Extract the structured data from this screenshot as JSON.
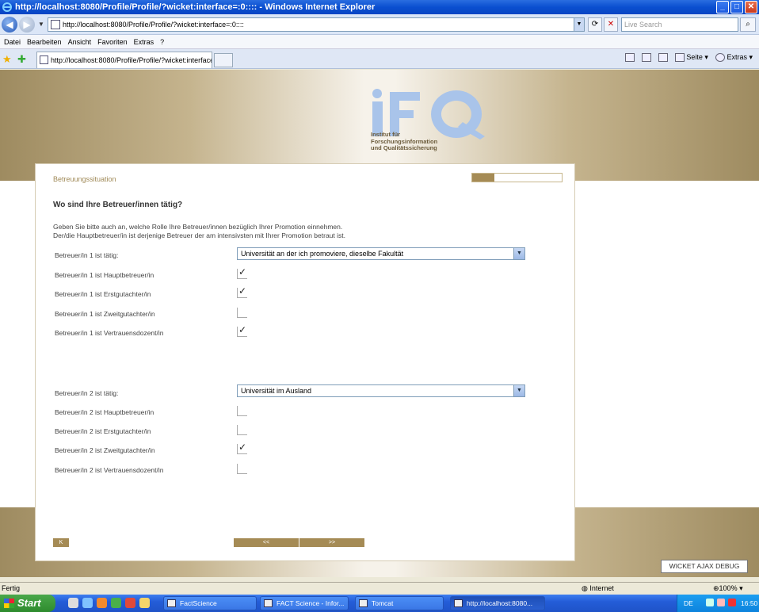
{
  "window": {
    "title": "http://localhost:8080/Profile/Profile/?wicket:interface=:0:::: - Windows Internet Explorer"
  },
  "addressbar": {
    "url": "http://localhost:8080/Profile/Profile/?wicket:interface=:0::::",
    "search_placeholder": "Live Search"
  },
  "menu": [
    "Datei",
    "Bearbeiten",
    "Ansicht",
    "Favoriten",
    "Extras",
    "?"
  ],
  "tab": {
    "title": "http://localhost:8080/Profile/Profile/?wicket:interface..."
  },
  "commandbar": {
    "page_label": "Seite",
    "tools_label": "Extras"
  },
  "logo": {
    "lines": [
      "Institut für",
      "Forschungsinformation",
      "und Qualitätssicherung"
    ]
  },
  "form": {
    "section_title": "Betreuungssituation",
    "progress": 0.25,
    "question": "Wo sind Ihre Betreuer/innen tätig?",
    "intro_lines": [
      "Geben Sie bitte auch an, welche Rolle Ihre Betreuer/innen bezüglich Ihrer Promotion einnehmen.",
      "Der/die Hauptbetreuer/in ist derjenige Betreuer der am intensivsten mit Ihrer Promotion betraut ist."
    ],
    "advisor1": {
      "workplace_label": "Betreuer/in 1 ist tätig:",
      "workplace_value": "Universität an der ich promoviere, dieselbe Fakultät",
      "roles": [
        {
          "label": "Betreuer/in 1 ist Hauptbetreuer/in",
          "checked": true
        },
        {
          "label": "Betreuer/in 1 ist Erstgutachter/in",
          "checked": true
        },
        {
          "label": "Betreuer/in 1 ist Zweitgutachter/in",
          "checked": false
        },
        {
          "label": "Betreuer/in 1 ist Vertrauensdozent/in",
          "checked": true
        }
      ]
    },
    "advisor2": {
      "workplace_label": "Betreuer/in 2 ist tätig:",
      "workplace_value": "Universität im Ausland",
      "roles": [
        {
          "label": "Betreuer/in 2 ist Hauptbetreuer/in",
          "checked": false
        },
        {
          "label": "Betreuer/in 2 ist Erstgutachter/in",
          "checked": false
        },
        {
          "label": "Betreuer/in 2 ist Zweitgutachter/in",
          "checked": true
        },
        {
          "label": "Betreuer/in 2 ist Vertrauensdozent/in",
          "checked": false
        }
      ]
    },
    "nav": {
      "k_label": "K",
      "back_label": "<<",
      "next_label": ">>"
    }
  },
  "debug_label": "WICKET AJAX DEBUG",
  "statusbar": {
    "status": "Fertig",
    "zone": "Internet",
    "zoom": "100%"
  },
  "taskbar": {
    "start_label": "Start",
    "buttons": [
      "FactScience",
      "FACT Science - Infor...",
      "Tomcat",
      "http://localhost:8080..."
    ],
    "language": "DE",
    "clock": "16:50"
  },
  "colors": {
    "brand_gold": "#a58b55",
    "logo_blue": "#a9c4ea",
    "xp_blue": "#245dd8"
  }
}
